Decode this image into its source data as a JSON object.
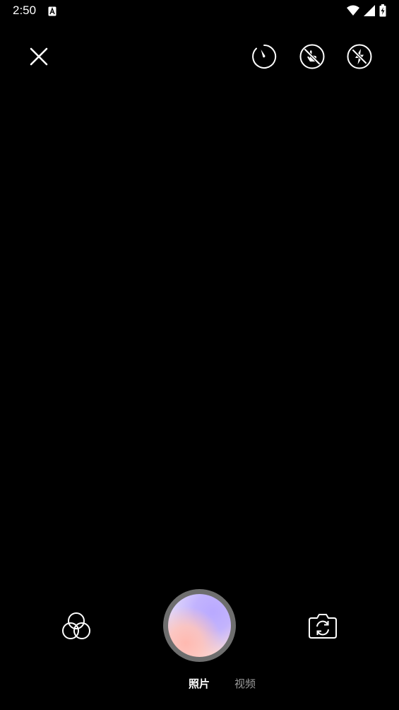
{
  "status_bar": {
    "time": "2:50",
    "icons": [
      "app-notification-icon",
      "wifi-icon",
      "cellular-signal-icon",
      "battery-charging-icon"
    ]
  },
  "top_controls": {
    "icons": [
      "close-icon",
      "timer-icon",
      "touch-capture-off-icon",
      "flash-off-icon"
    ]
  },
  "bottom_controls": {
    "icons": [
      "filter-icon",
      "shutter-button",
      "switch-camera-icon"
    ]
  },
  "modes": {
    "photo": "照片",
    "video": "视频",
    "selected": "照片"
  },
  "colors": {
    "background": "#000000",
    "icon": "#ffffff",
    "mode_selected": "#ffffff",
    "mode_unselected": "#9a9a9a",
    "shutter_ring": "#6e6e6e"
  }
}
